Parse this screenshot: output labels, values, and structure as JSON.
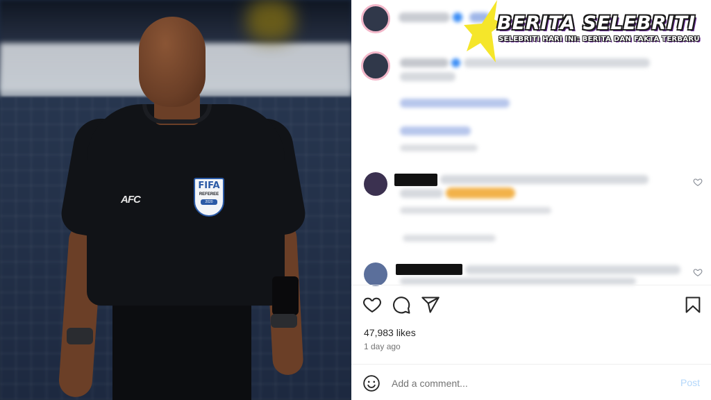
{
  "post": {
    "likes": "47,983 likes",
    "time_ago": "1 day ago",
    "comment_placeholder": "Add a comment...",
    "post_label": "Post"
  },
  "photo": {
    "badge_top": "FIFA",
    "badge_mid": "REFEREE",
    "badge_year": "2020",
    "chest_logo": "AFC"
  },
  "watermark": {
    "title": "BERITA SELEBRITI",
    "subtitle": "SELEBRITI HARI INI: BERITA DAN FAKTA TERBARU"
  },
  "icons": {
    "like": "heart-icon",
    "comment": "comment-icon",
    "share": "send-icon",
    "save": "bookmark-icon",
    "emoji": "emoji-icon"
  },
  "colors": {
    "accent_star": "#f5e62a",
    "post_button": "#b3d7fb",
    "watermark_shadow": "#6a2a9a"
  }
}
